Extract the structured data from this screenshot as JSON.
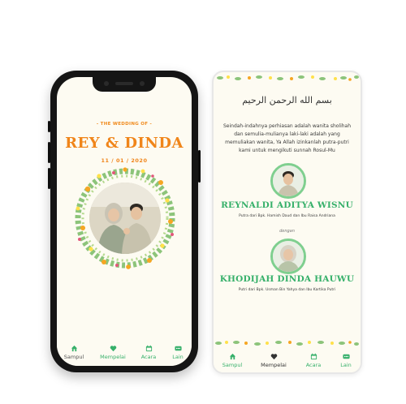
{
  "theme": {
    "accent_green": "#36b06a",
    "accent_orange": "#f0851a",
    "background_cream": "#fdfbf2"
  },
  "phone_screen": {
    "subtitle": "- THE WEDDING OF -",
    "names": "REY & DINDA",
    "date": "11 / 01 / 2020",
    "nav": [
      {
        "label": "Sampul",
        "icon": "home-icon",
        "active": false
      },
      {
        "label": "Mempelai",
        "icon": "heart-icon",
        "active": true
      },
      {
        "label": "Acara",
        "icon": "calendar-icon",
        "active": false
      },
      {
        "label": "Lain",
        "icon": "more-icon",
        "active": false
      }
    ]
  },
  "card_screen": {
    "arabic_text": "بسم الله الرحمن الرحيم",
    "verse": "Seindah-indahnya perhiasan adalah wanita sholihah dan semulia-mulianya laki-laki adalah yang memuliakan wanita, Ya Allah izinkanlah putra-putri kami untuk mengikuti sunnah Rosul-Mu",
    "groom": {
      "name": "REYNALDI ADITYA WISNU",
      "parents": "Putra dari Bpk. Hamish Daud dan Ibu Raisa Andriana"
    },
    "connector": "dengan",
    "bride": {
      "name": "KHODIJAH DINDA HAUWU",
      "parents": "Putri dari Bpk. Usman Bin Yahya dan Ibu Kartika Putri"
    },
    "nav": [
      {
        "label": "Sampul",
        "icon": "home-icon",
        "active": false
      },
      {
        "label": "Mempelai",
        "icon": "heart-icon",
        "active": true
      },
      {
        "label": "Acara",
        "icon": "calendar-icon",
        "active": false
      },
      {
        "label": "Lain",
        "icon": "more-icon",
        "active": false
      }
    ]
  }
}
